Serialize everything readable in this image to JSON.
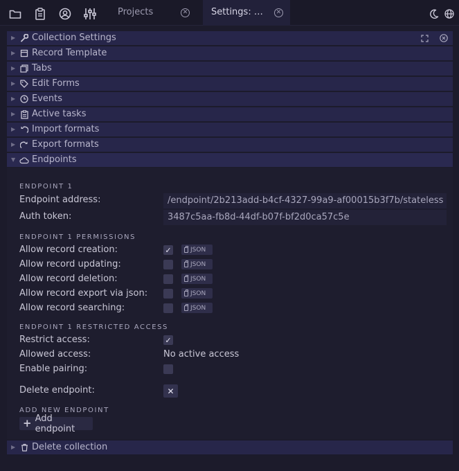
{
  "topbar": {
    "icons": [
      "folder-icon",
      "clipboard-icon",
      "account-icon",
      "sliders-icon"
    ],
    "tabs": [
      {
        "label": "Projects",
        "active": false
      },
      {
        "label": "Settings: …",
        "active": true
      }
    ],
    "right_icons": [
      "moon-icon",
      "globe-icon"
    ]
  },
  "sections": [
    {
      "label": "Collection Settings",
      "icon": "wrench-icon"
    },
    {
      "label": "Record Template",
      "icon": "template-icon"
    },
    {
      "label": "Tabs",
      "icon": "tabs-icon"
    },
    {
      "label": "Edit Forms",
      "icon": "tag-icon"
    },
    {
      "label": "Events",
      "icon": "clock-icon"
    },
    {
      "label": "Active tasks",
      "icon": "clipboard-icon"
    },
    {
      "label": "Import formats",
      "icon": "import-icon"
    },
    {
      "label": "Export formats",
      "icon": "export-icon"
    },
    {
      "label": "Endpoints",
      "icon": "cloud-icon"
    }
  ],
  "endpoint": {
    "heading": "ENDPOINT 1",
    "address_label": "Endpoint address:",
    "address_value": "/endpoint/2b213add-b4cf-4327-99a9-af00015b3f7b/stateless",
    "token_label": "Auth token:",
    "token_value": "3487c5aa-fb8d-44df-b07f-bf2d0ca57c5e",
    "permissions_heading": "ENDPOINT 1 PERMISSIONS",
    "permissions": [
      {
        "label": "Allow record creation:",
        "checked": true,
        "button": "JSON"
      },
      {
        "label": "Allow record updating:",
        "checked": false,
        "button": "JSON"
      },
      {
        "label": "Allow record deletion:",
        "checked": false,
        "button": "JSON"
      },
      {
        "label": "Allow record export via json:",
        "checked": false,
        "button": "JSON"
      },
      {
        "label": "Allow record searching:",
        "checked": false,
        "button": "JSON"
      }
    ],
    "restricted_heading": "ENDPOINT 1 RESTRICTED ACCESS",
    "restrict_label": "Restrict access:",
    "restrict_checked": true,
    "allowed_label": "Allowed access:",
    "allowed_value": "No active access",
    "pairing_label": "Enable pairing:",
    "pairing_checked": false,
    "delete_label": "Delete endpoint:",
    "add_heading": "ADD NEW ENDPOINT",
    "add_button": "Add endpoint"
  },
  "delete_collection": {
    "label": "Delete collection",
    "icon": "trash-icon"
  }
}
